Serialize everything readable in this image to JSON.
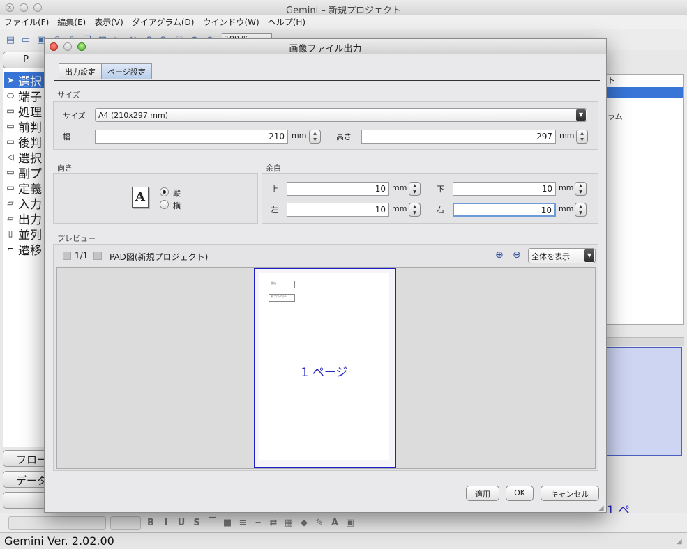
{
  "main_window": {
    "title": "Gemini – 新規プロジェクト",
    "menu": [
      "ファイル(F)",
      "編集(E)",
      "表示(V)",
      "ダイアグラム(D)",
      "ウインドウ(W)",
      "ヘルプ(H)"
    ],
    "zoom_value": "100 %",
    "palette_header": "P",
    "palette_items": [
      "選択",
      "端子",
      "処理",
      "前判",
      "後判",
      "選択",
      "副プ",
      "定義",
      "入力",
      "出力",
      "並列",
      "遷移"
    ],
    "left_buttons": [
      "フロー",
      "データ",
      ""
    ],
    "right_panel_rows": [
      "ト",
      "",
      "",
      "ラム"
    ],
    "right_preview_text": "1 ペ",
    "status": "Gemini  Ver. 2.02.00"
  },
  "dialog": {
    "title": "画像ファイル出力",
    "tabs": [
      "出力設定",
      "ページ設定"
    ],
    "active_tab": "ページ設定",
    "size_section": {
      "label": "サイズ",
      "size_label": "サイズ",
      "size_value": "A4 (210x297 mm)",
      "width_label": "幅",
      "width_value": "210",
      "height_label": "高さ",
      "height_value": "297",
      "unit": "mm"
    },
    "orientation_section": {
      "label": "向き",
      "icon_letter": "A",
      "portrait_label": "縦",
      "landscape_label": "横",
      "selected": "縦"
    },
    "margin_section": {
      "label": "余白",
      "top_label": "上",
      "top_value": "10",
      "bottom_label": "下",
      "bottom_value": "10",
      "left_label": "左",
      "left_value": "10",
      "right_label": "右",
      "right_value": "10",
      "unit": "mm"
    },
    "preview_section": {
      "label": "プレビュー",
      "page_counter": "1/1",
      "diagram_name": "PAD図(新規プロジェクト)",
      "zoom_option": "全体を表示",
      "page_label": "1 ページ",
      "mini_box_1": "開始",
      "mini_box_2": "新プログラム"
    },
    "buttons": {
      "apply": "適用",
      "ok": "OK",
      "cancel": "キャンセル"
    }
  }
}
